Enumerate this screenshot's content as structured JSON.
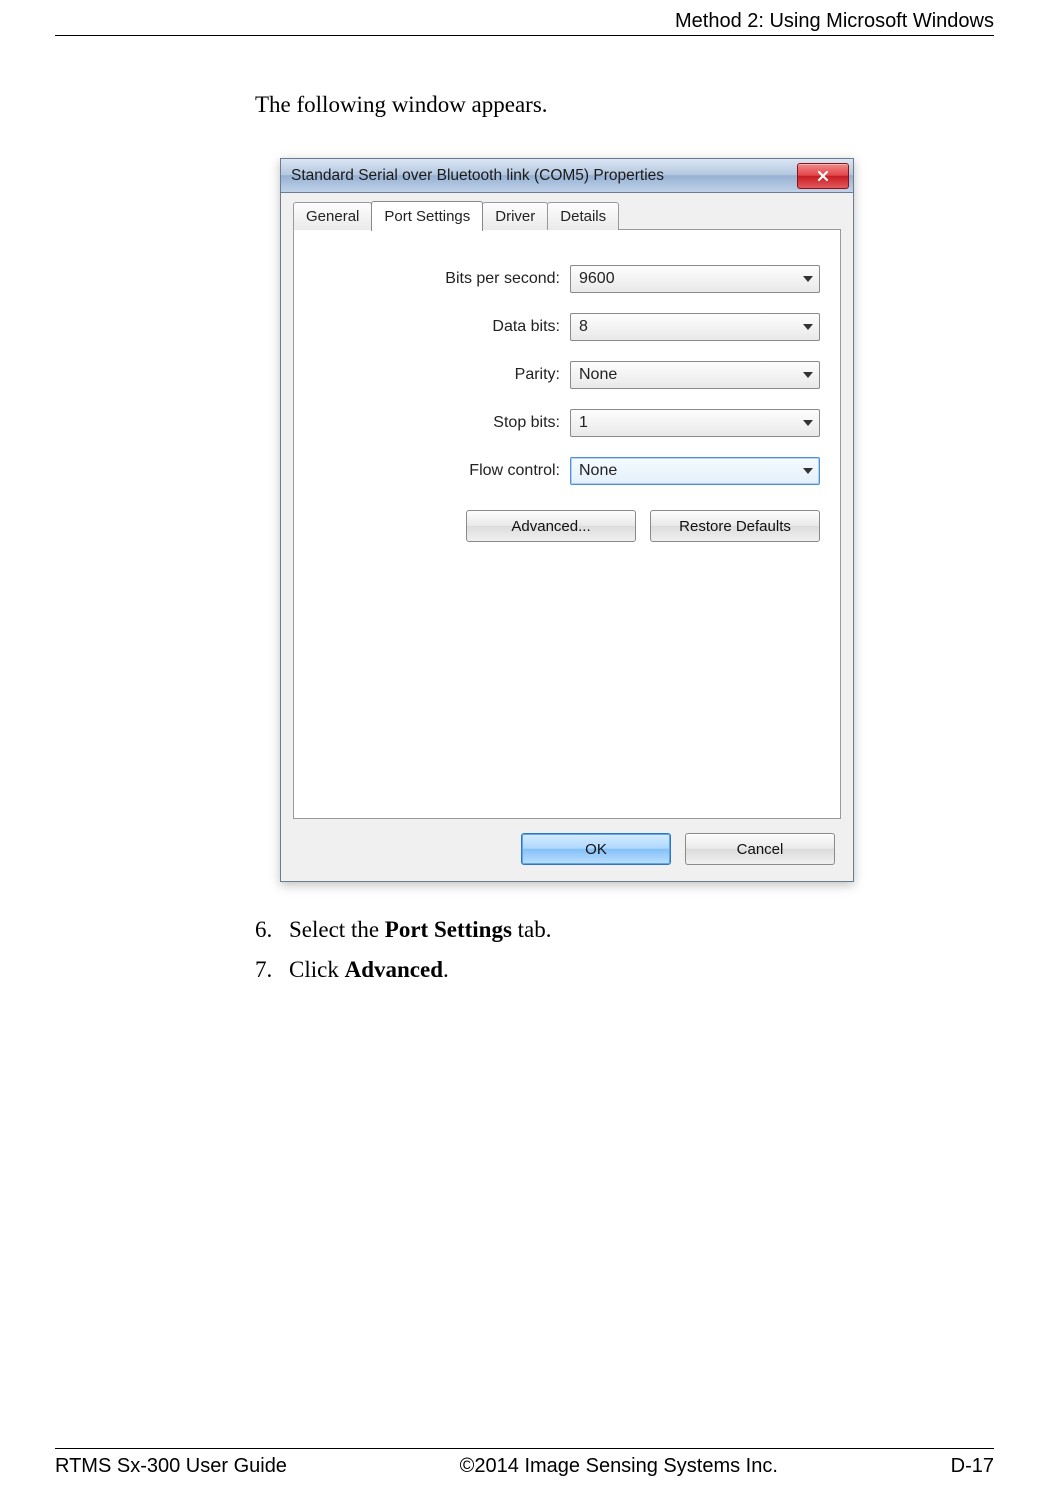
{
  "header": {
    "section_title": "Method 2: Using Microsoft Windows"
  },
  "intro_text": "The following window appears.",
  "dialog": {
    "title": "Standard Serial over Bluetooth link (COM5) Properties",
    "tabs": {
      "general": "General",
      "port_settings": "Port Settings",
      "driver": "Driver",
      "details": "Details"
    },
    "fields": {
      "bits_per_second": {
        "label": "Bits per second:",
        "value": "9600"
      },
      "data_bits": {
        "label": "Data bits:",
        "value": "8"
      },
      "parity": {
        "label": "Parity:",
        "value": "None"
      },
      "stop_bits": {
        "label": "Stop bits:",
        "value": "1"
      },
      "flow_control": {
        "label": "Flow control:",
        "value": "None"
      }
    },
    "buttons": {
      "advanced": "Advanced...",
      "restore_defaults": "Restore Defaults",
      "ok": "OK",
      "cancel": "Cancel"
    }
  },
  "steps": {
    "s6": {
      "num": "6.",
      "pre": "Select the ",
      "bold": "Port Settings",
      "post": " tab."
    },
    "s7": {
      "num": "7.",
      "pre": "Click ",
      "bold": "Advanced",
      "post": "."
    }
  },
  "footer": {
    "left": "RTMS Sx-300 User Guide",
    "center": "©2014 Image Sensing Systems Inc.",
    "right": "D-17"
  }
}
